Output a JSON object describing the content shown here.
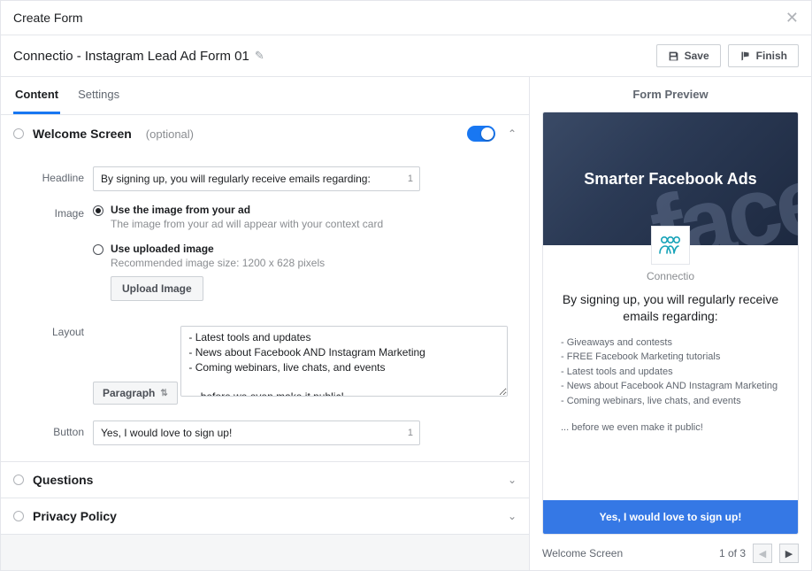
{
  "modal": {
    "title": "Create Form"
  },
  "header": {
    "form_name": "Connectio - Instagram Lead Ad Form 01",
    "save_label": "Save",
    "finish_label": "Finish"
  },
  "tabs": {
    "content": "Content",
    "settings": "Settings",
    "active": "content"
  },
  "sections": {
    "welcome": {
      "title": "Welcome Screen",
      "subtitle": "(optional)",
      "expanded": true,
      "toggle_on": true,
      "fields": {
        "headline": {
          "label": "Headline",
          "value": "By signing up, you will regularly receive emails regarding:",
          "counter": "1"
        },
        "image": {
          "label": "Image",
          "option_ad": {
            "label": "Use the image from your ad",
            "help": "The image from your ad will appear with your context card",
            "selected": true
          },
          "option_upload": {
            "label": "Use uploaded image",
            "help": "Recommended image size: 1200 x 628 pixels",
            "selected": false,
            "button": "Upload Image"
          }
        },
        "layout": {
          "label": "Layout",
          "value": "Paragraph",
          "textarea": "- Latest tools and updates\n- News about Facebook AND Instagram Marketing\n- Coming webinars, live chats, and events\n\n... before we even make it public!"
        },
        "button": {
          "label": "Button",
          "value": "Yes, I would love to sign up!",
          "counter": "1"
        }
      }
    },
    "questions": {
      "title": "Questions",
      "expanded": false
    },
    "privacy": {
      "title": "Privacy Policy",
      "expanded": false
    }
  },
  "preview": {
    "title": "Form Preview",
    "hero_text": "Smarter Facebook Ads",
    "brand": "Connectio",
    "headline": "By signing up, you will regularly receive emails regarding:",
    "bullets": [
      "- Giveaways and contests",
      "- FREE Facebook Marketing tutorials",
      "- Latest tools and updates",
      "- News about Facebook AND Instagram Marketing",
      "- Coming webinars, live chats, and events"
    ],
    "tagline": "... before we even make it public!",
    "cta": "Yes, I would love to sign up!",
    "pager": {
      "label": "Welcome Screen",
      "position": "1 of 3"
    }
  }
}
